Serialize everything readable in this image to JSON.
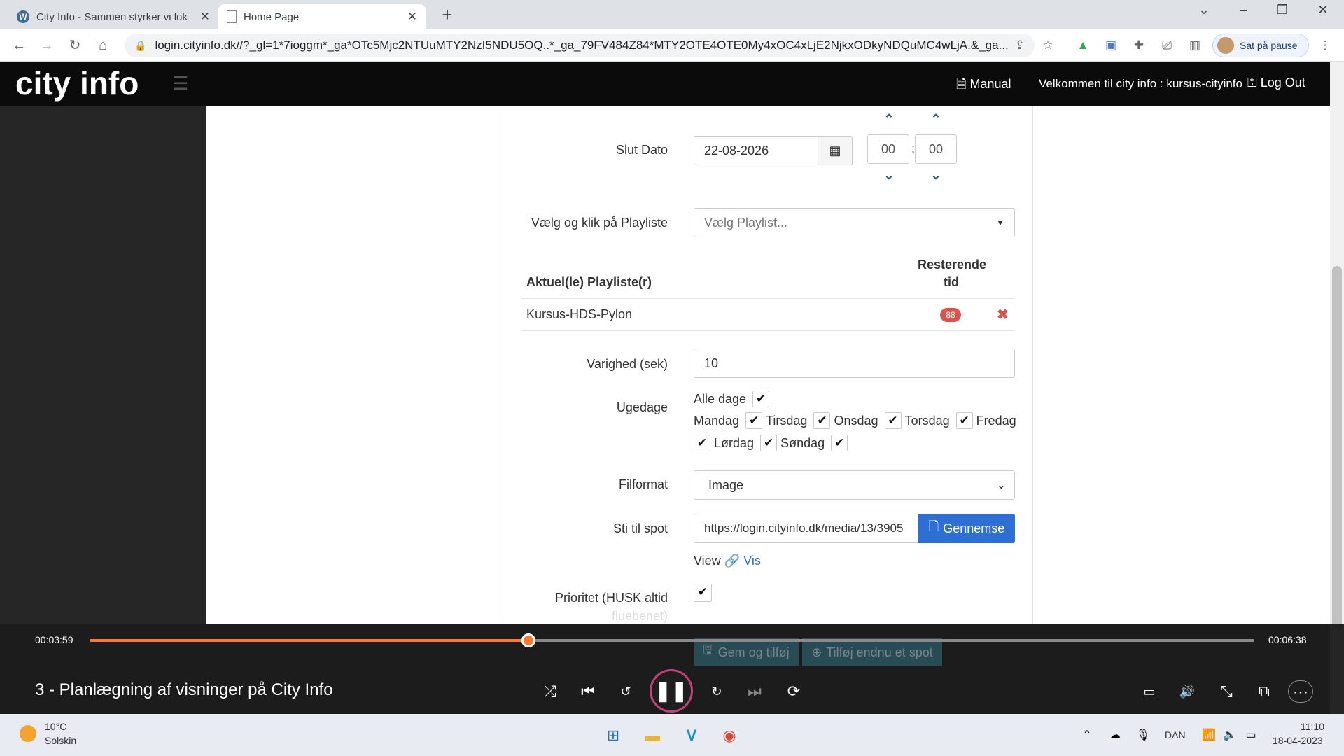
{
  "browser": {
    "tabs": [
      {
        "title": "City Info - Sammen styrker vi lok",
        "active": false
      },
      {
        "title": "Home Page",
        "active": true
      }
    ],
    "url": "login.cityinfo.dk//?_gl=1*7ioggm*_ga*OTc5Mjc2NTUuMTY2NzI5NDU5OQ..*_ga_79FV484Z84*MTY2OTE4OTE0My4xOC4xLjE2NjkxODkyNDQuMC4wLjA.&_ga...",
    "profile_label": "Sat på pause"
  },
  "header": {
    "logo": "city info",
    "manual": "Manual",
    "welcome": "Velkommen til city info : kursus-cityinfo",
    "logout": "Log Out"
  },
  "form": {
    "slut_dato_label": "Slut Dato",
    "slut_dato_value": "22-08-2026",
    "hour": "00",
    "minute": "00",
    "time_separator": ":",
    "playlist_label": "Vælg og klik på Playliste",
    "playlist_placeholder": "Vælg Playlist...",
    "current_playlists_header": "Aktuel(le) Playliste(r)",
    "remaining_header_1": "Resterende",
    "remaining_header_2": "tid",
    "playlist_row_name": "Kursus-HDS-Pylon",
    "playlist_row_remaining": "88",
    "varighed_label": "Varighed (sek)",
    "varighed_value": "10",
    "ugedage_label": "Ugedage",
    "alle_dage": "Alle dage",
    "days": {
      "mandag": "Mandag",
      "tirsdag": "Tirsdag",
      "onsdag": "Onsdag",
      "torsdag": "Torsdag",
      "fredag": "Fredag",
      "lordag": "Lørdag",
      "sondag": "Søndag"
    },
    "filformat_label": "Filformat",
    "filformat_value": "Image",
    "sti_label": "Sti til spot",
    "sti_value": "https://login.cityinfo.dk/media/13/3905",
    "browse_button": "Gennemse",
    "view_label": "View",
    "vis_label": "Vis",
    "prioritet_label_1": "Prioritet (HUSK altid",
    "prioritet_label_2": "fluebenet)",
    "save_button": "Gem og tilføj",
    "add_button": "Tilføj endnu et spot"
  },
  "player": {
    "current_time": "00:03:59",
    "total_time": "00:06:38",
    "progress": 0.377,
    "title": "3 - Planlægning af visninger på City Info"
  },
  "taskbar": {
    "temperature": "10°C",
    "weather": "Solskin",
    "language": "DAN",
    "time": "11:10",
    "date": "18-04-2023"
  },
  "colors": {
    "accent_orange": "#ff7a2f",
    "primary_blue": "#2d6fd2",
    "danger_red": "#d9534f"
  }
}
